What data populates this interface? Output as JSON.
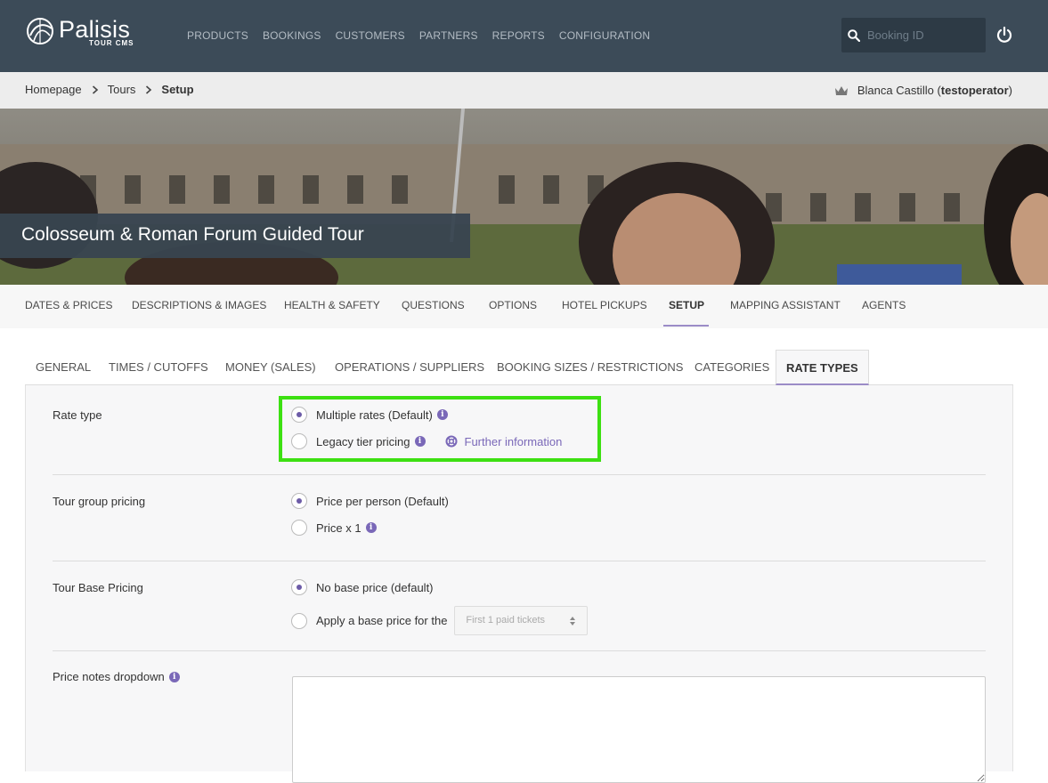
{
  "app": {
    "logo_name": "Palisis",
    "logo_sub": "TOUR CMS"
  },
  "nav": {
    "items": [
      "PRODUCTS",
      "BOOKINGS",
      "CUSTOMERS",
      "PARTNERS",
      "REPORTS",
      "CONFIGURATION"
    ]
  },
  "search": {
    "placeholder": "Booking ID",
    "value": ""
  },
  "breadcrumb": {
    "items": [
      "Homepage",
      "Tours"
    ],
    "current": "Setup"
  },
  "user": {
    "name": "Blanca Castillo",
    "account": "testoperator"
  },
  "tour": {
    "title": "Colosseum & Roman Forum Guided Tour"
  },
  "subnav": {
    "items": [
      "DATES & PRICES",
      "DESCRIPTIONS & IMAGES",
      "HEALTH & SAFETY",
      "QUESTIONS",
      "OPTIONS",
      "HOTEL PICKUPS",
      "SETUP",
      "MAPPING ASSISTANT",
      "AGENTS"
    ],
    "active": "SETUP"
  },
  "tabs": {
    "items": [
      "GENERAL",
      "TIMES / CUTOFFS",
      "MONEY (SALES)",
      "OPERATIONS / SUPPLIERS",
      "BOOKING SIZES / RESTRICTIONS",
      "CATEGORIES",
      "RATE TYPES"
    ],
    "active": "RATE TYPES"
  },
  "form": {
    "rate_type": {
      "label": "Rate type",
      "options": [
        "Multiple rates (Default)",
        "Legacy tier pricing"
      ],
      "selected": "Multiple rates (Default)",
      "further_info": "Further information"
    },
    "group_pricing": {
      "label": "Tour group pricing",
      "options": [
        "Price per person (Default)",
        "Price x 1"
      ],
      "selected": "Price per person (Default)"
    },
    "base_pricing": {
      "label": "Tour Base Pricing",
      "options": [
        "No base price (default)",
        "Apply a base price for the"
      ],
      "selected": "No base price (default)",
      "select_value": "First 1 paid tickets"
    },
    "price_notes": {
      "label": "Price notes dropdown",
      "value": ""
    }
  },
  "colors": {
    "header": "#3c4b58",
    "accent": "#7a68b8",
    "highlight": "#3de012"
  }
}
